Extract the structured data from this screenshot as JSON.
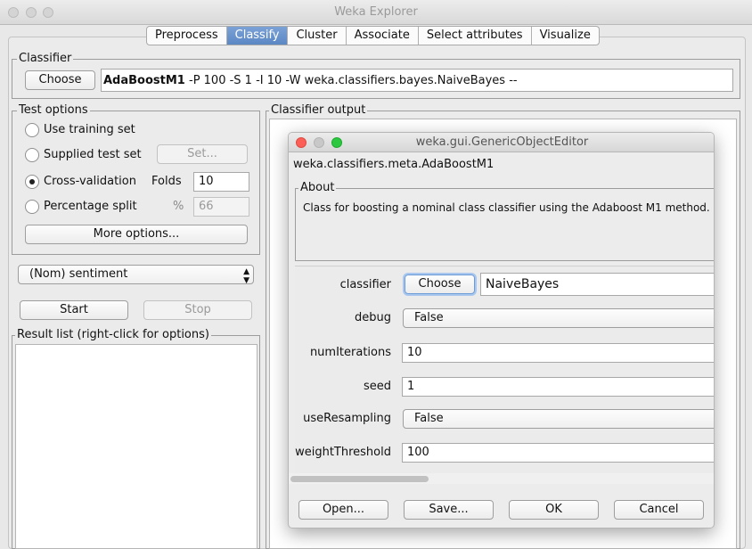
{
  "window": {
    "title": "Weka Explorer"
  },
  "tabs": [
    {
      "label": "Preprocess"
    },
    {
      "label": "Classify"
    },
    {
      "label": "Cluster"
    },
    {
      "label": "Associate"
    },
    {
      "label": "Select attributes"
    },
    {
      "label": "Visualize"
    }
  ],
  "classifier": {
    "group_label": "Classifier",
    "choose_label": "Choose",
    "name": "AdaBoostM1",
    "options": "-P 100 -S 1 -I 10 -W weka.classifiers.bayes.NaiveBayes --"
  },
  "test_options": {
    "group_label": "Test options",
    "use_training_set": "Use training set",
    "supplied_test_set": "Supplied test set",
    "set_button": "Set...",
    "cross_validation": "Cross-validation",
    "folds_label": "Folds",
    "folds_value": "10",
    "percentage_split": "Percentage split",
    "percent_symbol": "%",
    "percent_value": "66",
    "more_options": "More options..."
  },
  "class_attribute": {
    "selected": "(Nom) sentiment"
  },
  "actions": {
    "start": "Start",
    "stop": "Stop"
  },
  "result_list": {
    "group_label": "Result list (right-click for options)"
  },
  "classifier_output": {
    "group_label": "Classifier output"
  },
  "dialog": {
    "title": "weka.gui.GenericObjectEditor",
    "class_name": "weka.classifiers.meta.AdaBoostM1",
    "about_label": "About",
    "about_text": "Class for boosting a nominal class classifier using the Adaboost M1 method.",
    "properties": {
      "classifier_label": "classifier",
      "classifier_choose": "Choose",
      "classifier_value": "NaiveBayes",
      "debug_label": "debug",
      "debug_value": "False",
      "numIterations_label": "numIterations",
      "numIterations_value": "10",
      "seed_label": "seed",
      "seed_value": "1",
      "useResampling_label": "useResampling",
      "useResampling_value": "False",
      "weightThreshold_label": "weightThreshold",
      "weightThreshold_value": "100"
    },
    "buttons": {
      "open": "Open...",
      "save": "Save...",
      "ok": "OK",
      "cancel": "Cancel"
    },
    "colors": {
      "close": "#fc5f57",
      "minimize": "#c8c8c8",
      "zoom": "#2bc840"
    }
  },
  "icons": [
    "close-icon",
    "minimize-icon",
    "zoom-icon",
    "combo-arrows-icon"
  ]
}
